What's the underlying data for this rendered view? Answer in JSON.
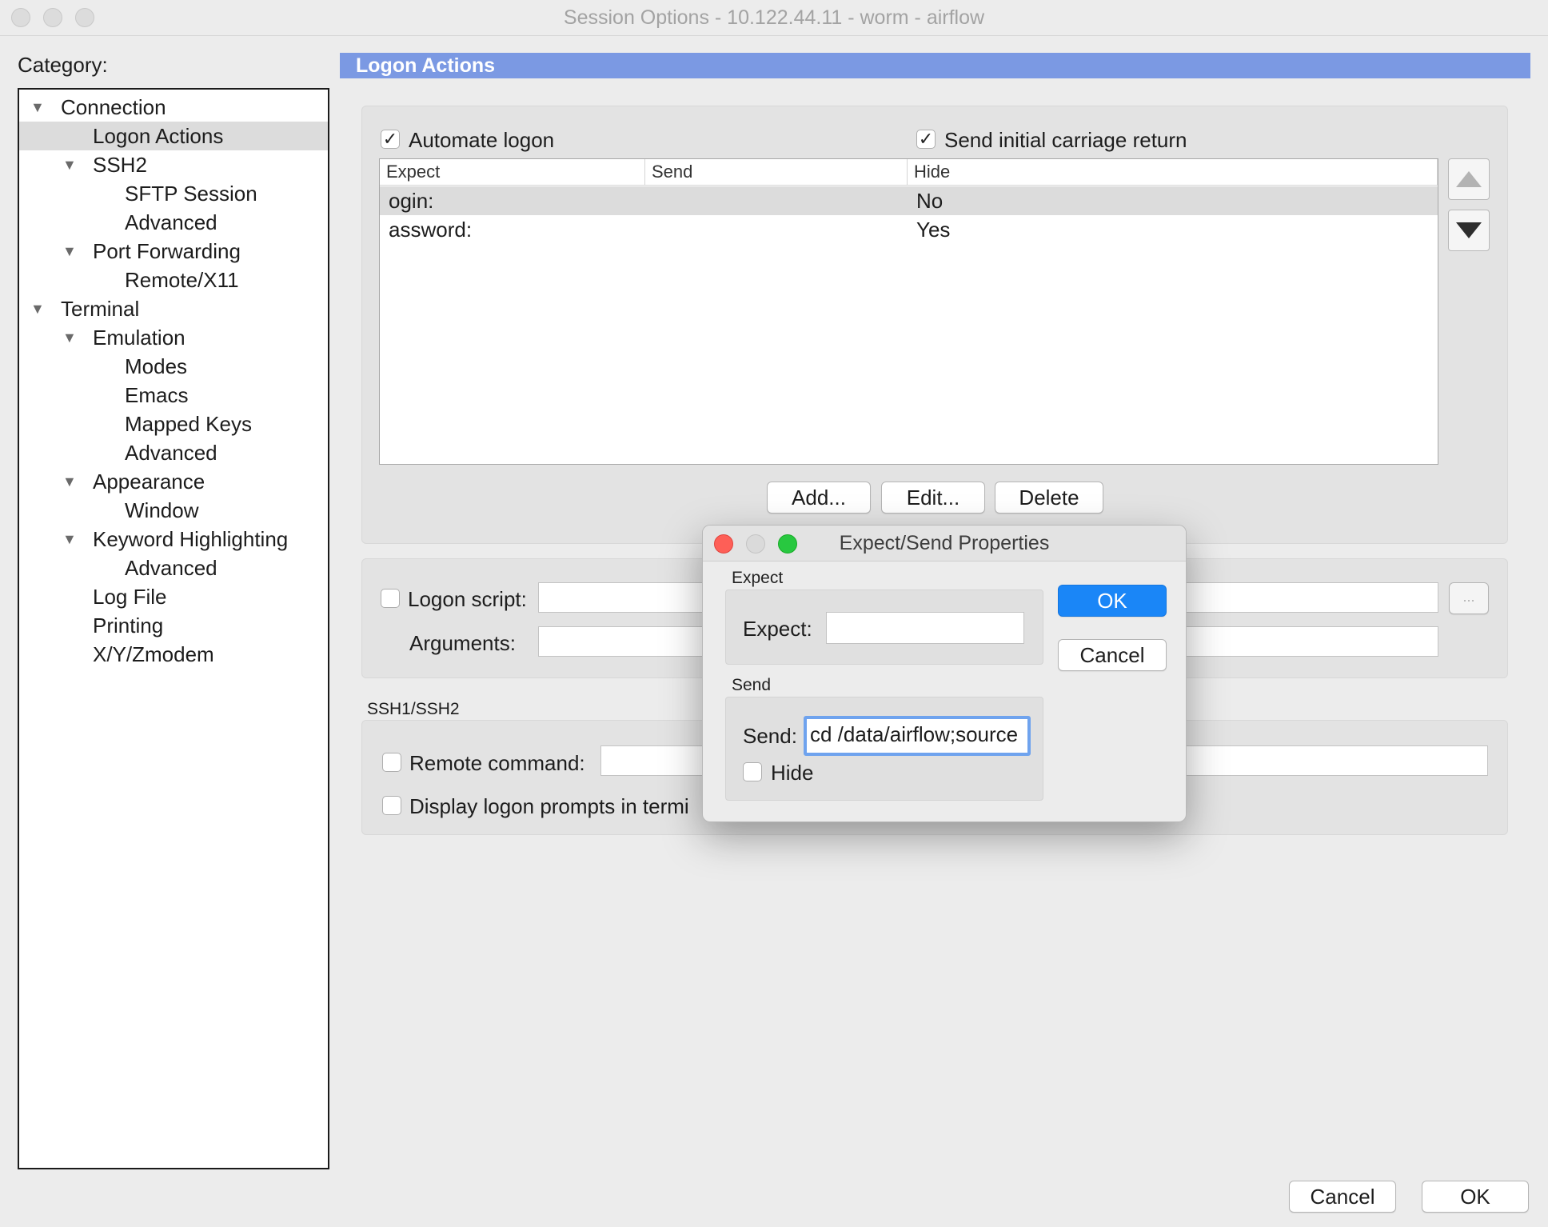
{
  "window": {
    "title": "Session Options - 10.122.44.11 - worm - airflow"
  },
  "sidebar": {
    "label": "Category:",
    "items": [
      {
        "label": "Connection",
        "expanded": true
      },
      {
        "label": "Logon Actions",
        "selected": true
      },
      {
        "label": "SSH2",
        "expanded": true
      },
      {
        "label": "SFTP Session"
      },
      {
        "label": "Advanced"
      },
      {
        "label": "Port Forwarding",
        "expanded": true
      },
      {
        "label": "Remote/X11"
      },
      {
        "label": "Terminal",
        "expanded": true
      },
      {
        "label": "Emulation",
        "expanded": true
      },
      {
        "label": "Modes"
      },
      {
        "label": "Emacs"
      },
      {
        "label": "Mapped Keys"
      },
      {
        "label": "Advanced"
      },
      {
        "label": "Appearance",
        "expanded": true
      },
      {
        "label": "Window"
      },
      {
        "label": "Keyword Highlighting",
        "expanded": true
      },
      {
        "label": "Advanced"
      },
      {
        "label": "Log File"
      },
      {
        "label": "Printing"
      },
      {
        "label": "X/Y/Zmodem"
      }
    ]
  },
  "main": {
    "header": "Logon Actions",
    "automate_logon": {
      "label": "Automate logon",
      "checked": true
    },
    "send_cr": {
      "label": "Send initial carriage return",
      "checked": true
    },
    "table": {
      "columns": [
        "Expect",
        "Send",
        "Hide"
      ],
      "rows": [
        {
          "expect": "ogin:",
          "send": "",
          "hide": "No"
        },
        {
          "expect": "assword:",
          "send": "",
          "hide": "Yes"
        }
      ]
    },
    "buttons": {
      "add": "Add...",
      "edit": "Edit...",
      "delete": "Delete",
      "browse": "..."
    },
    "logon_script": {
      "label": "Logon script:",
      "checked": false,
      "value": ""
    },
    "arguments": {
      "label": "Arguments:",
      "value": ""
    },
    "ssh_section": "SSH1/SSH2",
    "remote_command": {
      "label": "Remote command:",
      "checked": false,
      "value": ""
    },
    "display_prompts": {
      "label": "Display logon prompts in termi",
      "checked": false
    }
  },
  "footer": {
    "cancel": "Cancel",
    "ok": "OK"
  },
  "dialog": {
    "title": "Expect/Send Properties",
    "expect_section": "Expect",
    "expect_label": "Expect:",
    "expect_value": "",
    "send_section": "Send",
    "send_label": "Send:",
    "send_value": "cd /data/airflow;source",
    "hide_label": "Hide",
    "hide_checked": false,
    "ok": "OK",
    "cancel": "Cancel"
  },
  "colors": {
    "header_band": "#7b99e3",
    "primary_button": "#1a86f7",
    "focus_ring": "#6fa3ee",
    "close_light": "#fe5f57",
    "zoom_light": "#28c840"
  }
}
